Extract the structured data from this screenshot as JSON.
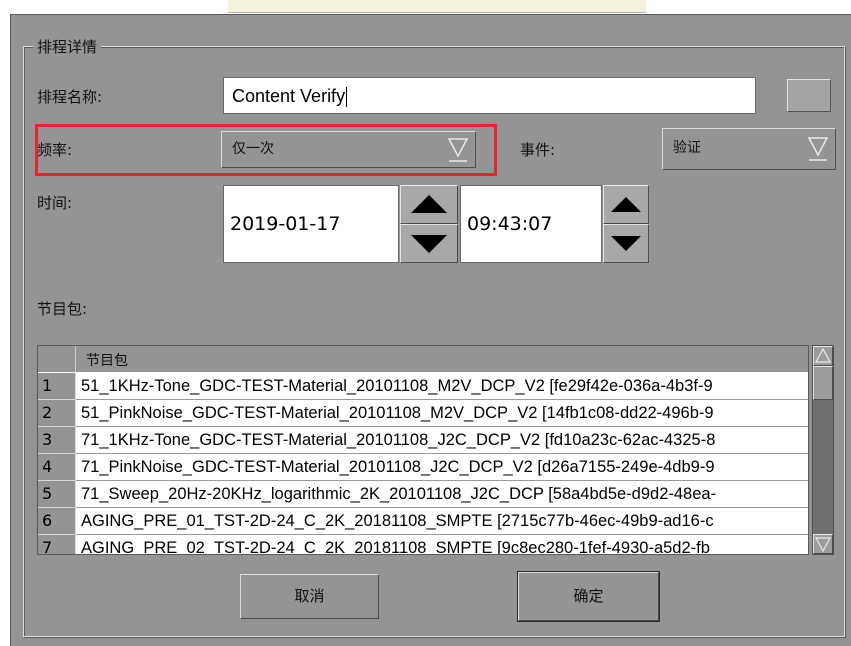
{
  "group_title": "排程详情",
  "name_label": "排程名称:",
  "name_value": "Content Verify",
  "frequency": {
    "label": "频率:",
    "value": "仅一次"
  },
  "event": {
    "label": "事件:",
    "value": "验证"
  },
  "time": {
    "label": "时间:",
    "date": "2019-01-17",
    "clock": "09:43:07"
  },
  "package_label": "节目包:",
  "table": {
    "header": "节目包",
    "rows": [
      {
        "num": "1",
        "text": "51_1KHz-Tone_GDC-TEST-Material_20101108_M2V_DCP_V2 [fe29f42e-036a-4b3f-9"
      },
      {
        "num": "2",
        "text": "51_PinkNoise_GDC-TEST-Material_20101108_M2V_DCP_V2 [14fb1c08-dd22-496b-9"
      },
      {
        "num": "3",
        "text": "71_1KHz-Tone_GDC-TEST-Material_20101108_J2C_DCP_V2 [fd10a23c-62ac-4325-8"
      },
      {
        "num": "4",
        "text": "71_PinkNoise_GDC-TEST-Material_20101108_J2C_DCP_V2 [d26a7155-249e-4db9-9"
      },
      {
        "num": "5",
        "text": "71_Sweep_20Hz-20KHz_logarithmic_2K_20101108_J2C_DCP [58a4bd5e-d9d2-48ea-"
      },
      {
        "num": "6",
        "text": "AGING_PRE_01_TST-2D-24_C_2K_20181108_SMPTE [2715c77b-46ec-49b9-ad16-c"
      },
      {
        "num": "7",
        "text": "AGING_PRE_02_TST-2D-24_C_2K_20181108_SMPTE [9c8ec280-1fef-4930-a5d2-fb"
      }
    ]
  },
  "buttons": {
    "cancel": "取消",
    "ok": "确定"
  },
  "colors": {
    "window_bg": "#949494",
    "highlight_border": "#e8242e",
    "field_bg": "#ffffff"
  },
  "icons": [
    "dropdown-arrow-icon",
    "spin-up-icon",
    "spin-down-icon",
    "scroll-up-icon",
    "scroll-down-icon"
  ]
}
